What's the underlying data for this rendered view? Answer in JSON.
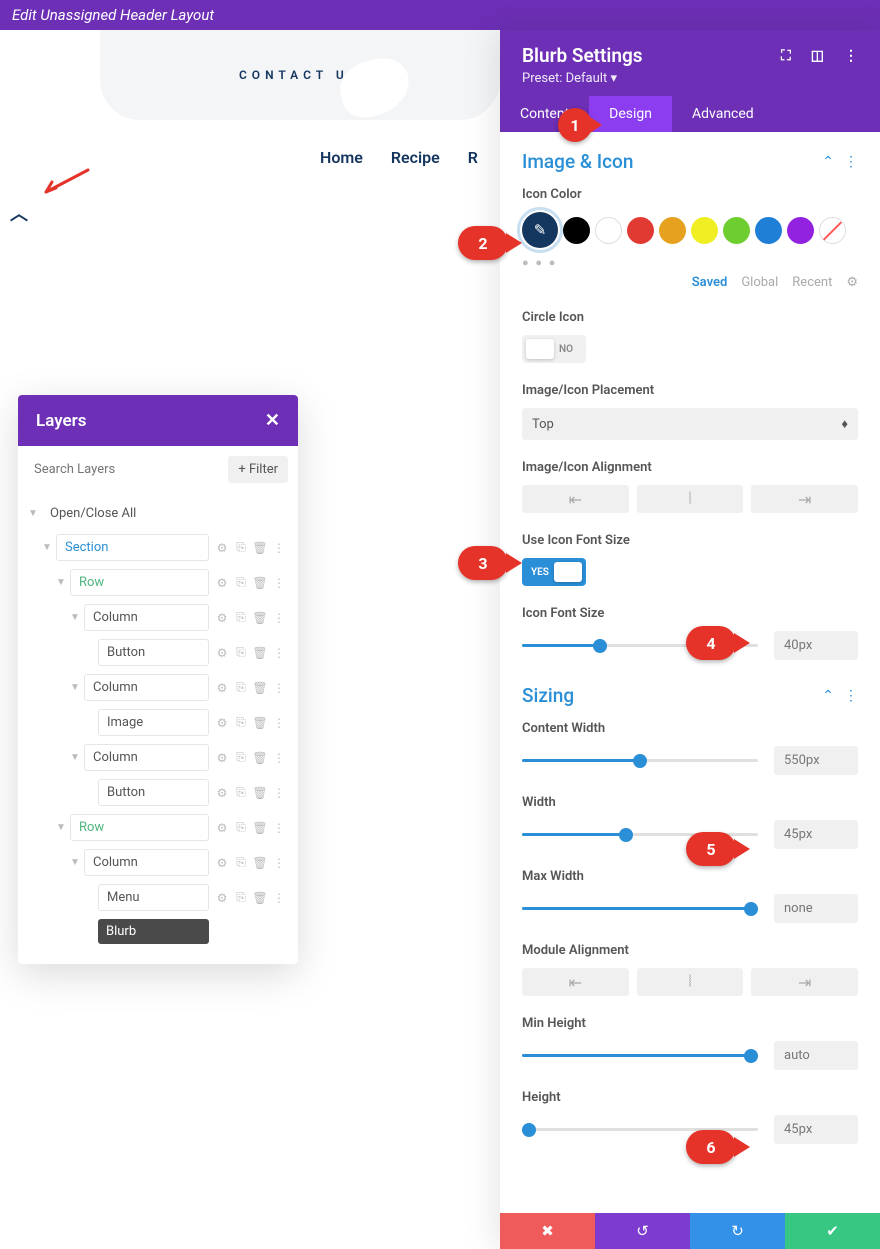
{
  "top_bar": {
    "title": "Edit Unassigned Header Layout"
  },
  "contact": {
    "text": "CONTACT US"
  },
  "nav": {
    "items": [
      "Home",
      "Recipe",
      "R"
    ]
  },
  "layers": {
    "title": "Layers",
    "search_placeholder": "Search Layers",
    "filter": "Filter",
    "open_close": "Open/Close All",
    "tree": [
      {
        "label": "Section",
        "type": "section",
        "indent": 1
      },
      {
        "label": "Row",
        "type": "row",
        "indent": 2
      },
      {
        "label": "Column",
        "type": "col",
        "indent": 3
      },
      {
        "label": "Button",
        "type": "mod",
        "indent": 4
      },
      {
        "label": "Column",
        "type": "col",
        "indent": 3
      },
      {
        "label": "Image",
        "type": "mod",
        "indent": 4
      },
      {
        "label": "Column",
        "type": "col",
        "indent": 3
      },
      {
        "label": "Button",
        "type": "mod",
        "indent": 4
      },
      {
        "label": "Row",
        "type": "row",
        "indent": 2
      },
      {
        "label": "Column",
        "type": "col",
        "indent": 3
      },
      {
        "label": "Menu",
        "type": "mod",
        "indent": 4
      },
      {
        "label": "Blurb",
        "type": "mod",
        "indent": 4,
        "active": true
      }
    ]
  },
  "settings": {
    "title": "Blurb Settings",
    "preset": "Preset: Default",
    "tabs": {
      "content": "Content",
      "design": "Design",
      "advanced": "Advanced"
    },
    "image_icon": {
      "title": "Image & Icon",
      "icon_color": {
        "label": "Icon Color",
        "colors": [
          "#13375e",
          "#000000",
          "#ffffff",
          "#e13a32",
          "#e6a11f",
          "#eeee22",
          "#6fce2f",
          "#1f7fd6",
          "#9322e0"
        ],
        "saved": "Saved",
        "global": "Global",
        "recent": "Recent"
      },
      "circle_icon": {
        "label": "Circle Icon",
        "value": "NO"
      },
      "placement": {
        "label": "Image/Icon Placement",
        "value": "Top"
      },
      "alignment": {
        "label": "Image/Icon Alignment"
      },
      "use_font_size": {
        "label": "Use Icon Font Size",
        "value": "YES"
      },
      "font_size": {
        "label": "Icon Font Size",
        "value": "40px",
        "percent": 33
      }
    },
    "sizing": {
      "title": "Sizing",
      "content_width": {
        "label": "Content Width",
        "value": "550px",
        "percent": 50
      },
      "width": {
        "label": "Width",
        "value": "45px",
        "percent": 44
      },
      "max_width": {
        "label": "Max Width",
        "value": "none",
        "percent": 97
      },
      "module_alignment": {
        "label": "Module Alignment"
      },
      "min_height": {
        "label": "Min Height",
        "value": "auto",
        "percent": 97
      },
      "height": {
        "label": "Height",
        "value": "45px",
        "percent": 3
      }
    }
  },
  "annotations": {
    "1": "1",
    "2": "2",
    "3": "3",
    "4": "4",
    "5": "5",
    "6": "6"
  }
}
